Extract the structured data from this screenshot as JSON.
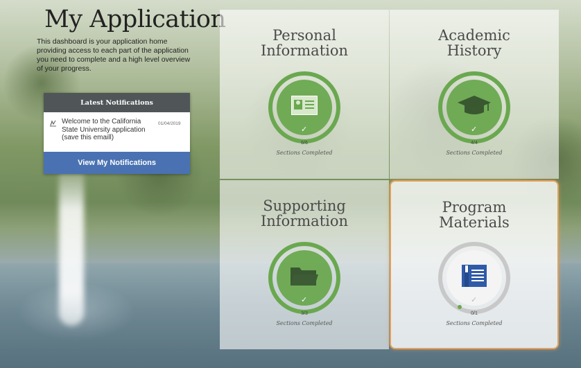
{
  "page": {
    "title": "My Application",
    "intro": "This dashboard is your application home providing access to each part of the application you need to complete and a high level overview of your progress."
  },
  "notifications": {
    "header": "Latest Notifications",
    "items": [
      {
        "text": "Welcome to the California State University application (save this emaill)",
        "date": "01/04/2019"
      }
    ],
    "button_label": "View My Notifications"
  },
  "cards": [
    {
      "title_line1": "Personal",
      "title_line2": "Information",
      "progress": "6/6",
      "completed": 6,
      "total": 6,
      "caption": "Sections Completed",
      "icon": "id-card-icon",
      "check": "✓"
    },
    {
      "title_line1": "Academic",
      "title_line2": "History",
      "progress": "4/4",
      "completed": 4,
      "total": 4,
      "caption": "Sections Completed",
      "icon": "graduation-cap-icon",
      "check": "✓"
    },
    {
      "title_line1": "Supporting",
      "title_line2": "Information",
      "progress": "3/3",
      "completed": 3,
      "total": 3,
      "caption": "Sections Completed",
      "icon": "folder-icon",
      "check": "✓"
    },
    {
      "title_line1": "Program",
      "title_line2": "Materials",
      "progress": "0/1",
      "completed": 0,
      "total": 1,
      "caption": "Sections Completed",
      "icon": "book-icon",
      "check": "✓"
    }
  ],
  "colors": {
    "complete_green": "#6aa84f",
    "ring_gray": "#c8c8c8",
    "icon_blue": "#2f5aa8",
    "active_border": "#e2a05c",
    "button_blue": "#4a72b2",
    "header_gray": "#505658"
  }
}
